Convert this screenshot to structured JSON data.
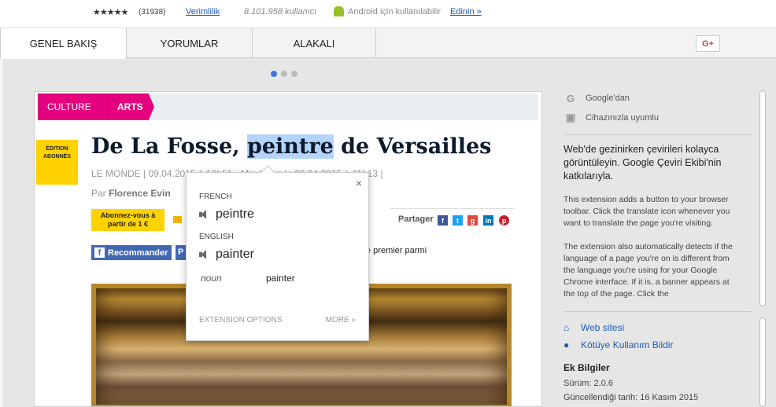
{
  "header": {
    "stars": "★★★★★",
    "rating_count": "(31938)",
    "productivity_link": "Verimlilik",
    "users": "8.101.958 kullanıcı",
    "android_text": "Android için kullanılabilir",
    "android_link": "Edinin »"
  },
  "tabs": [
    {
      "label": "GENEL BAKIŞ"
    },
    {
      "label": "YORUMLAR"
    },
    {
      "label": "ALAKALI"
    }
  ],
  "gplus_label": "G+",
  "screenshot": {
    "category1": "CULTURE",
    "category2": "ARTS",
    "edition_badge": "ÉDITION ABONNÉS",
    "headline_pre": "De La Fosse, ",
    "headline_highlight": "peintre",
    "headline_post": " de Versailles",
    "meta": "LE MONDE | 09.04.2015 à 10h51 • Mis à jour le 09.04.2015 à 11h13 |",
    "author_prefix": "Par ",
    "author_name": "Florence Evin",
    "subscribe_button": "Abonnez-vous à partir de 1 €",
    "share_label": "Partager",
    "fb_recommend": "Recommander",
    "fb_p": "P",
    "fb_text": "z le premier parmi"
  },
  "translate_popup": {
    "close": "×",
    "source_lang": "FRENCH",
    "source_word": "peintre",
    "target_lang": "ENGLISH",
    "target_word": "painter",
    "pos": "noun",
    "pos_translation": "painter",
    "options": "EXTENSION OPTIONS",
    "more": "MORE »"
  },
  "sidebar": {
    "google_label": "Google'dan",
    "compat_label": "Cihazınızla uyumlu",
    "summary": "Web'de gezinirken çevirileri kolayca görüntüleyin. Google Çeviri Ekibi'nin katkılarıyla.",
    "desc1": "This extension adds a button to your browser toolbar. Click the translate icon whenever you want to translate the page you're visiting.",
    "desc2": "The extension also automatically detects if the language of a page you're on is different from the language you're using for your Google Chrome interface. If it is, a banner appears at the top of the page. Click the",
    "website_link": "Web sitesi",
    "report_link": "Kötüye Kullanım Bildir",
    "extra_title": "Ek Bilgiler",
    "version_label": "Sürüm:",
    "version_value": "2.0.6",
    "updated_label": "Güncellendiği tarih:",
    "updated_value": "16 Kasım 2015"
  },
  "colors": {
    "accent_blue": "#1c5ab8",
    "culture_pink": "#e5007e",
    "highlight": "#b3d4fc"
  }
}
